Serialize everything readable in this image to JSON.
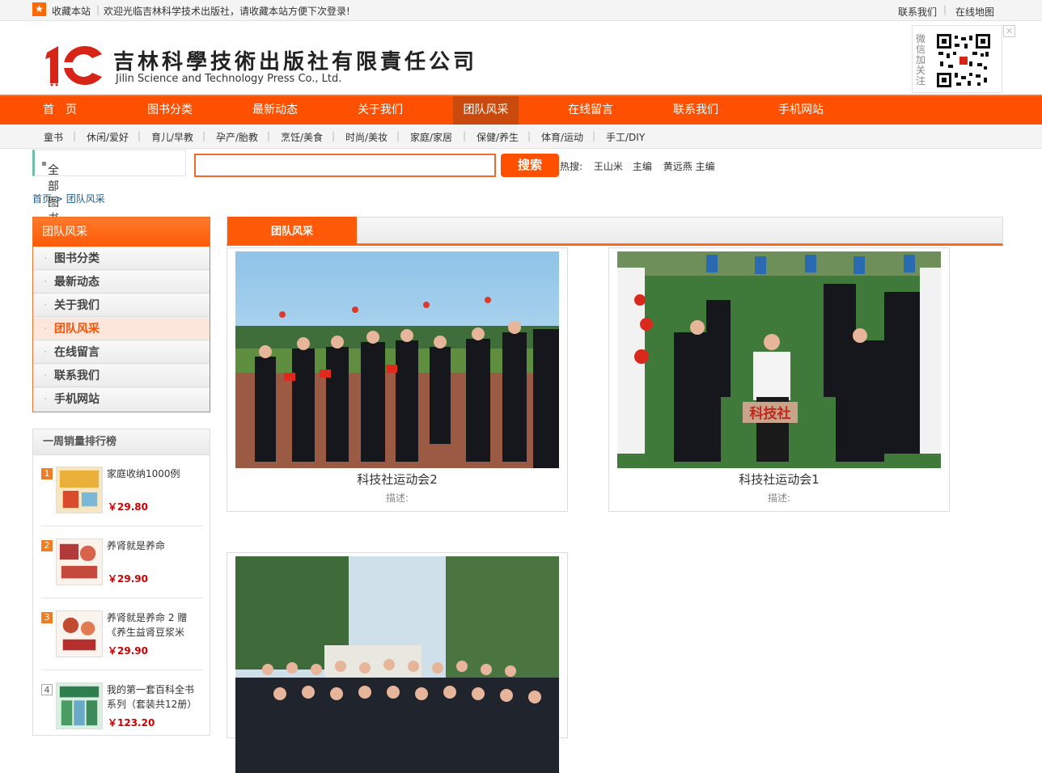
{
  "topbar": {
    "favorite": "收藏本站",
    "welcome": "欢迎光临吉林科学技术出版社，请收藏本站方便下次登录!",
    "contact": "联系我们",
    "sitemap": "在线地图"
  },
  "header": {
    "logo_cn": "吉林科學技術出版社有限責任公司",
    "logo_en": "Jilin Science and Technology Press  Co., Ltd.",
    "wechat_label": "微信加关注",
    "close_icon": "close-icon"
  },
  "nav": [
    {
      "label": "首　页",
      "active": false
    },
    {
      "label": "图书分类",
      "active": false
    },
    {
      "label": "最新动态",
      "active": false
    },
    {
      "label": "关于我们",
      "active": false
    },
    {
      "label": "团队风采",
      "active": true
    },
    {
      "label": "在线留言",
      "active": false
    },
    {
      "label": "联系我们",
      "active": false
    },
    {
      "label": "手机网站",
      "active": false
    }
  ],
  "subnav": [
    "童书",
    "休闲/爱好",
    "育儿/早教",
    "孕产/胎教",
    "烹饪/美食",
    "时尚/美妆",
    "家庭/家居",
    "保健/养生",
    "体育/运动",
    "手工/DIY"
  ],
  "search": {
    "all_books": "全部图书",
    "button": "搜索",
    "hot_label": "热搜:",
    "hot_words": [
      "王山米　主编",
      "黄远燕 主编"
    ]
  },
  "breadcrumb": {
    "home": "首页",
    "sep": " > ",
    "current": "团队风采"
  },
  "sidebar": {
    "title": "团队风采",
    "items": [
      {
        "label": "图书分类",
        "active": false
      },
      {
        "label": "最新动态",
        "active": false
      },
      {
        "label": "关于我们",
        "active": false
      },
      {
        "label": "团队风采",
        "active": true
      },
      {
        "label": "在线留言",
        "active": false
      },
      {
        "label": "联系我们",
        "active": false
      },
      {
        "label": "手机网站",
        "active": false
      }
    ]
  },
  "ranking": {
    "title": "一周销量排行榜",
    "items": [
      {
        "rank": "1",
        "title": "家庭收纳1000例",
        "price": "￥29.80",
        "cover_color": "#e9b13a"
      },
      {
        "rank": "2",
        "title": "养肾就是养命",
        "price": "￥29.90",
        "cover_color": "#b33a3a"
      },
      {
        "rank": "3",
        "title": "养肾就是养命 2 赠《养生益肾豆浆米",
        "price": "￥29.90",
        "cover_color": "#c14a32"
      },
      {
        "rank": "4",
        "title": "我的第一套百科全书系列（套装共12册）",
        "price": "￥123.20",
        "cover_color": "#2f7f4e"
      }
    ]
  },
  "main": {
    "tab": "团队风采",
    "cards": [
      {
        "caption": "科技社运动会2",
        "desc": "描述:"
      },
      {
        "caption": "科技社运动会1",
        "desc": "描述:"
      },
      {
        "caption": "",
        "desc": ""
      }
    ]
  },
  "colors": {
    "accent": "#ff5001",
    "price": "#cc0000",
    "link": "#1a5a8a"
  }
}
